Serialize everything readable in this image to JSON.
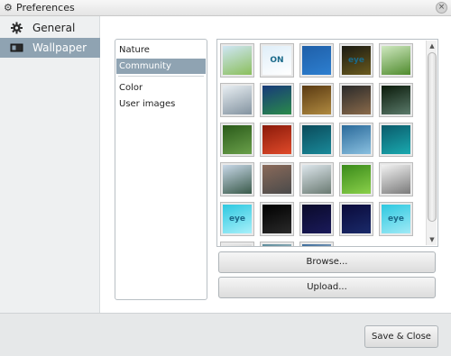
{
  "window": {
    "title": "Preferences",
    "close_label": "×"
  },
  "sidebar": {
    "items": [
      {
        "label": "General"
      },
      {
        "label": "Wallpaper"
      }
    ]
  },
  "categories": {
    "items": [
      {
        "label": "Nature"
      },
      {
        "label": "Community"
      },
      {
        "label": "Color"
      },
      {
        "label": "User images"
      }
    ]
  },
  "buttons": {
    "browse": "Browse...",
    "upload": "Upload...",
    "save_close": "Save & Close"
  },
  "thumbnails": [
    {
      "colors": [
        "#cfe6f5",
        "#8bbf5c"
      ]
    },
    {
      "colors": [
        "#dfeef8",
        "#ffffff"
      ],
      "caption": "ON"
    },
    {
      "colors": [
        "#1f5fa8",
        "#2d7fd0"
      ]
    },
    {
      "colors": [
        "#1a1a12",
        "#6a5a1e"
      ],
      "caption": "eye"
    },
    {
      "colors": [
        "#cfe8c0",
        "#4f8b2d"
      ]
    },
    {
      "colors": [
        "#e8eef2",
        "#8393a0"
      ]
    },
    {
      "colors": [
        "#173a7a",
        "#2a8a4a"
      ]
    },
    {
      "colors": [
        "#5a3a12",
        "#b08a40"
      ]
    },
    {
      "colors": [
        "#2a2a2a",
        "#8a6a4a"
      ]
    },
    {
      "colors": [
        "#0a1a0a",
        "#5a7a6a"
      ]
    },
    {
      "colors": [
        "#2a5a1a",
        "#6aa04a"
      ]
    },
    {
      "colors": [
        "#8a1a0a",
        "#e04a2a"
      ]
    },
    {
      "colors": [
        "#0a4a5a",
        "#1a8a9a"
      ]
    },
    {
      "colors": [
        "#2a6a9a",
        "#8ac0e0"
      ]
    },
    {
      "colors": [
        "#0a5a6a",
        "#1aaab0"
      ]
    },
    {
      "colors": [
        "#c8d8e8",
        "#3a5a4a"
      ]
    },
    {
      "colors": [
        "#8a6a5a",
        "#4a4a4a"
      ]
    },
    {
      "colors": [
        "#dde6ec",
        "#6a7a72"
      ]
    },
    {
      "colors": [
        "#3a8a1a",
        "#8ad04a"
      ]
    },
    {
      "colors": [
        "#f2f2f2",
        "#7a7a7a"
      ]
    },
    {
      "colors": [
        "#2ec8e0",
        "#a8f0fa"
      ],
      "caption": "eye"
    },
    {
      "colors": [
        "#000000",
        "#2a2a2a"
      ]
    },
    {
      "colors": [
        "#0a0a2a",
        "#1a1a5a"
      ]
    },
    {
      "colors": [
        "#0a0a3a",
        "#1a2a6a"
      ]
    },
    {
      "colors": [
        "#2ec8e0",
        "#a0eaf6"
      ],
      "caption": "eye"
    },
    {
      "colors": [
        "#e8e8e8",
        "#c0c0c0"
      ]
    },
    {
      "colors": [
        "#5a8a9a",
        "#e8e8e8"
      ]
    },
    {
      "colors": [
        "#3a6a9a",
        "#e8e8e8"
      ]
    }
  ]
}
